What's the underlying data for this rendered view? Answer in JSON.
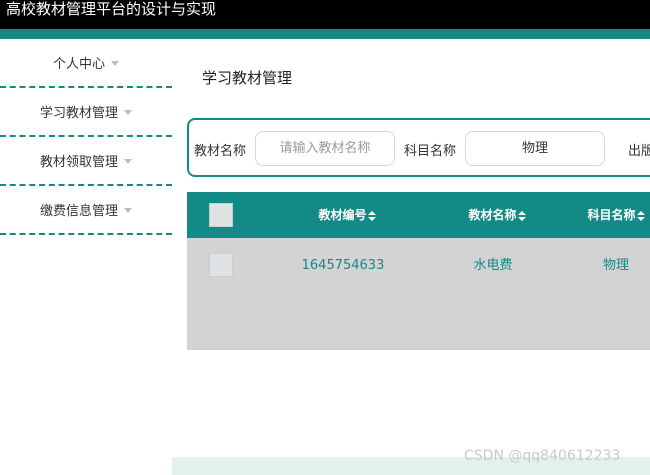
{
  "app": {
    "title": "高校教材管理平台的设计与实现"
  },
  "sidebar": {
    "items": [
      {
        "label": "个人中心"
      },
      {
        "label": "学习教材管理"
      },
      {
        "label": "教材领取管理"
      },
      {
        "label": "缴费信息管理"
      }
    ]
  },
  "page": {
    "title": "学习教材管理"
  },
  "search": {
    "name_label": "教材名称",
    "name_placeholder": "请输入教材名称",
    "subject_label": "科目名称",
    "subject_value": "物理",
    "publisher_label": "出版"
  },
  "table": {
    "headers": [
      "教材编号",
      "教材名称",
      "科目名称"
    ],
    "rows": [
      {
        "code": "1645754633",
        "name": "水电费",
        "subject": "物理"
      }
    ]
  },
  "watermark": "CSDN @qq840612233",
  "colors": {
    "accent": "#138a86",
    "topbar": "#000000",
    "row_bg": "#d3d3d3"
  },
  "icons": {
    "menu_caret": "chevron-down-icon",
    "sort": "sort-icon"
  }
}
